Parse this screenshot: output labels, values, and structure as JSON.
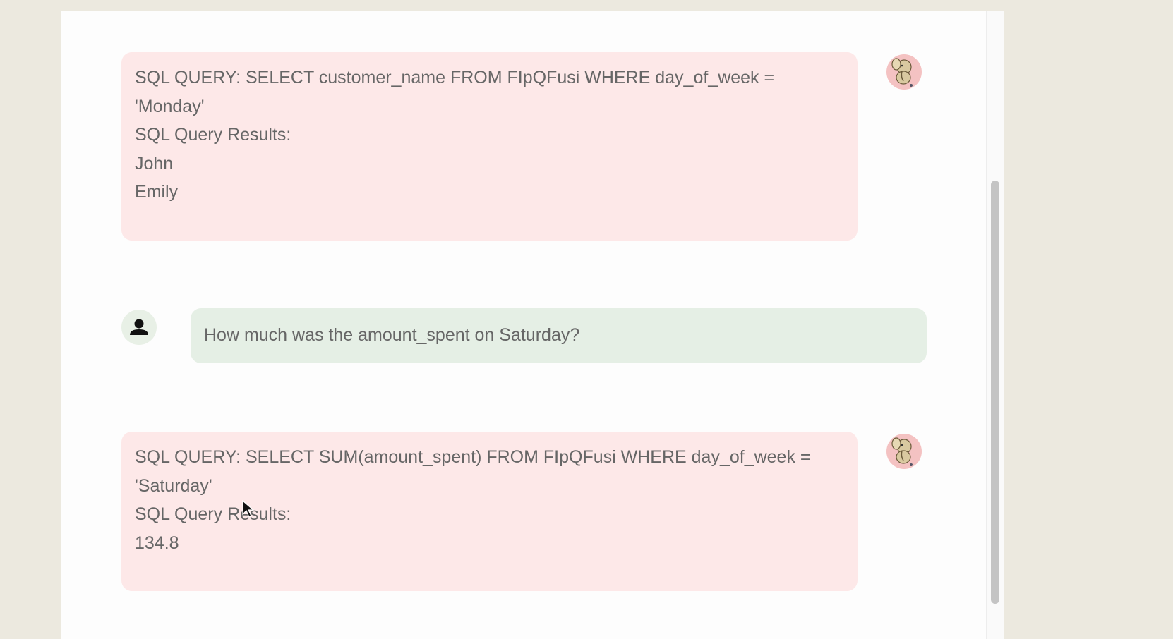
{
  "messages": [
    {
      "role": "bot",
      "lines": [
        "SQL QUERY: SELECT customer_name FROM FIpQFusi WHERE day_of_week =",
        "'Monday'",
        "SQL Query Results:",
        "John",
        "Emily"
      ]
    },
    {
      "role": "user",
      "text": "How much was the amount_spent on Saturday?"
    },
    {
      "role": "bot",
      "lines": [
        "SQL QUERY: SELECT SUM(amount_spent) FROM FIpQFusi WHERE day_of_week =",
        "'Saturday'",
        "SQL Query Results:",
        "134.8"
      ]
    }
  ],
  "icons": {
    "bot_avatar": "elephant-icon",
    "user_avatar": "person-icon",
    "cursor": "mouse-pointer-icon"
  },
  "colors": {
    "bot_bubble": "#fde8e8",
    "user_bubble": "#e5efe5",
    "bot_avatar_bg": "#f4c2c2",
    "user_avatar_bg": "#e8f0e6"
  }
}
